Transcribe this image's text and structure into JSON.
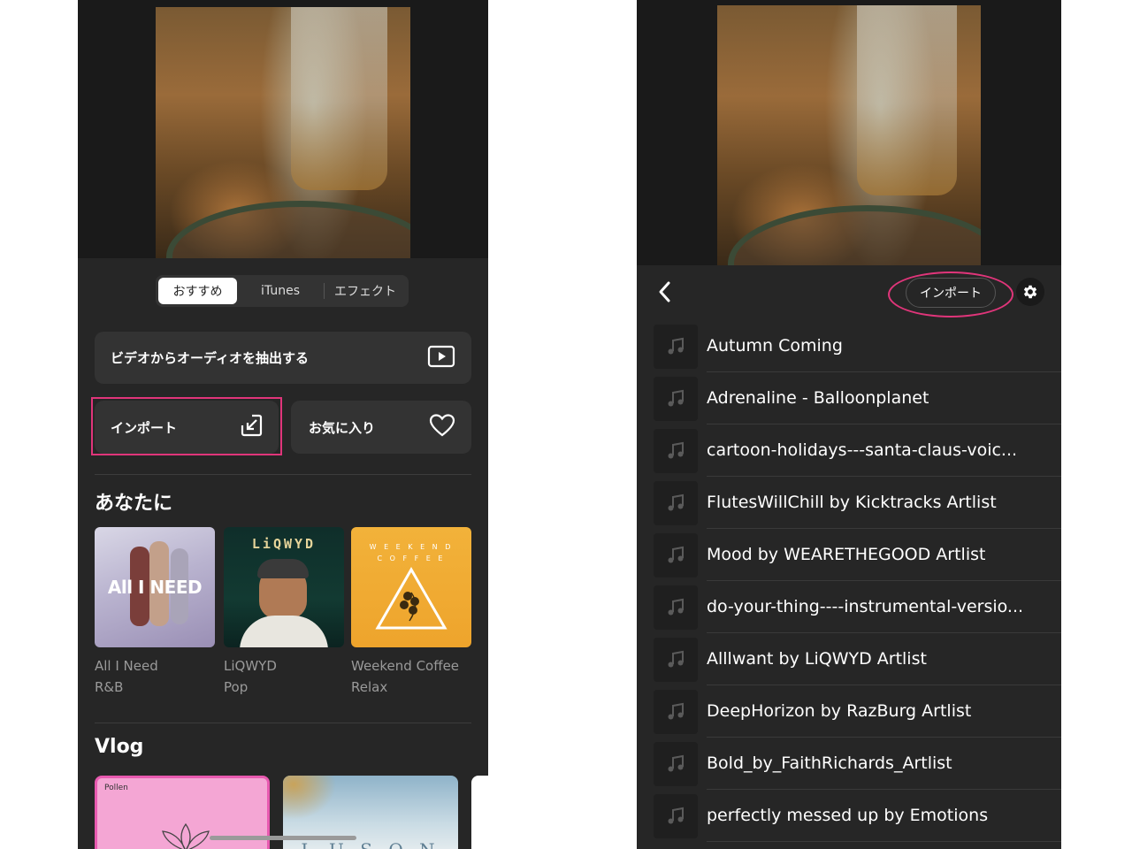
{
  "left": {
    "tabs": [
      {
        "label": "おすすめ",
        "active": true
      },
      {
        "label": "iTunes",
        "active": false
      },
      {
        "label": "エフェクト",
        "active": false
      }
    ],
    "extract_audio_label": "ビデオからオーディオを抽出する",
    "import_label": "インポート",
    "favorites_label": "お気に入り",
    "for_you_title": "あなたに",
    "albums": [
      {
        "name": "All I Need",
        "genre": "R&B",
        "art_text": "All I NEED"
      },
      {
        "name": "LiQWYD",
        "genre": "Pop",
        "art_text": "LiQWYD"
      },
      {
        "name": "Weekend Coffee",
        "genre": "Relax",
        "art_text": "W E E K E N D   C O F F E E"
      }
    ],
    "vlog_title": "Vlog",
    "vlog_items": [
      {
        "art_text": "Pollen"
      },
      {
        "art_text": "L U S O N"
      }
    ]
  },
  "right": {
    "import_label": "インポート",
    "tracks": [
      "Autumn Coming",
      "Adrenaline - Balloonplanet",
      "cartoon-holidays---santa-claus-voic...",
      "FlutesWillChill by Kicktracks Artlist",
      "Mood by WEARETHEGOOD Artlist",
      "do-your-thing----instrumental-versio...",
      "Alllwant by LiQWYD Artlist",
      "DeepHorizon by RazBurg Artlist",
      "Bold_by_FaithRichards_Artlist",
      "perfectly messed up  by Emotions"
    ]
  },
  "colors": {
    "panel_bg": "#262626",
    "card_bg": "#333333",
    "highlight": "#e0357a"
  }
}
